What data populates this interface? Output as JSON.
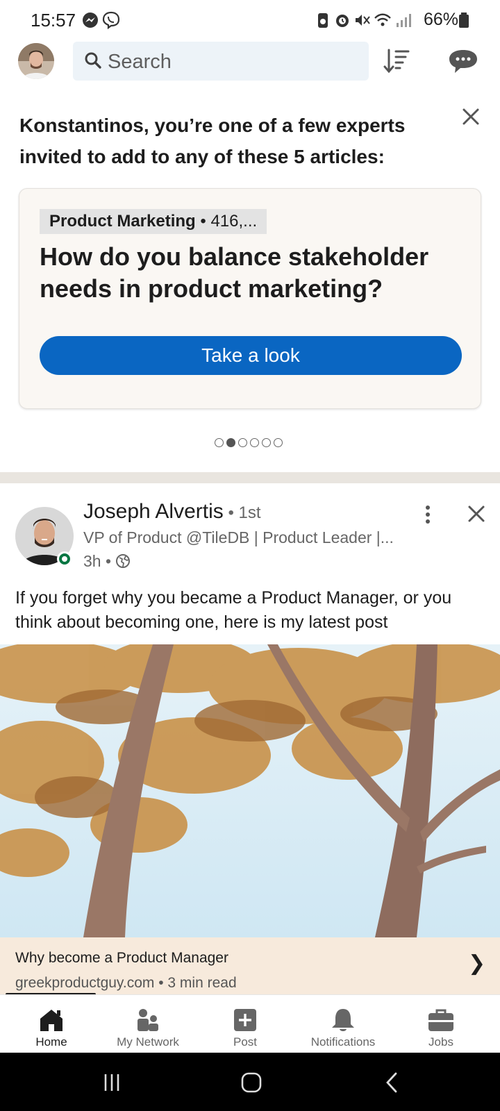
{
  "status_bar": {
    "time": "15:57",
    "battery": "66%",
    "left_icons": [
      "messenger-icon",
      "viber-icon"
    ],
    "right_icons": [
      "battery-saver-icon",
      "alarm-icon",
      "mute-icon",
      "wifi-icon",
      "signal-icon",
      "battery-icon"
    ]
  },
  "top_bar": {
    "search_placeholder": "Search"
  },
  "invitation": {
    "title": "Konstantinos, you’re one of a few experts invited to add to any of these 5 articles:",
    "card": {
      "topic": "Product Marketing",
      "topic_meta": " • 416,...",
      "question": "How do you balance stakeholder needs in product marketing?",
      "cta": "Take a look"
    },
    "carousel": {
      "count": 6,
      "active_index": 1
    }
  },
  "post": {
    "author": "Joseph Alvertis",
    "degree": " • 1st",
    "headline": "VP of Product @TileDB | Product Leader |...",
    "time": "3h •",
    "text": "If you forget why you became a Product Manager, or you think about becoming one, here is my latest post",
    "link": {
      "title": "Why become a Product Manager",
      "subtitle": "greekproductguy.com • 3 min read",
      "chevron": "❯"
    }
  },
  "bottom_nav": {
    "items": [
      {
        "label": "Home",
        "icon": "home-icon",
        "active": true
      },
      {
        "label": "My Network",
        "icon": "network-icon",
        "active": false
      },
      {
        "label": "Post",
        "icon": "post-icon",
        "active": false
      },
      {
        "label": "Notifications",
        "icon": "bell-icon",
        "active": false
      },
      {
        "label": "Jobs",
        "icon": "briefcase-icon",
        "active": false
      }
    ]
  },
  "colors": {
    "primary": "#0a66c2",
    "online": "#057642",
    "link_card_bg": "#f7eadc"
  }
}
